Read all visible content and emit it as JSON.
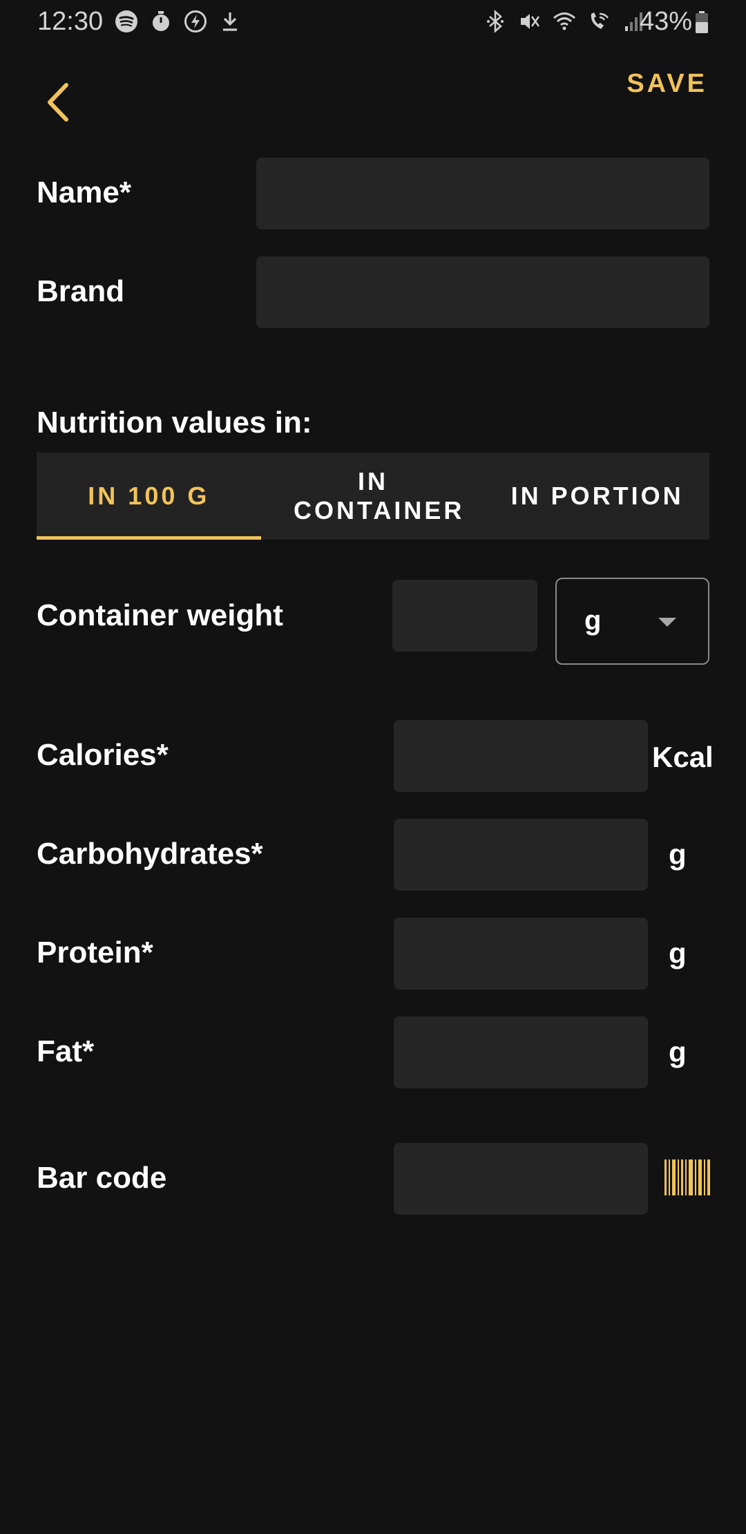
{
  "status_bar": {
    "time": "12:30",
    "battery": "43%",
    "left_icons": [
      "spotify-icon",
      "stopwatch-icon",
      "flash-icon",
      "download-icon"
    ],
    "right_icons": [
      "bluetooth-icon",
      "mute-icon",
      "wifi-icon",
      "wifi-calling-icon",
      "signal-icon",
      "battery-icon"
    ]
  },
  "header": {
    "back_icon": "chevron-left-icon",
    "save_label": "SAVE"
  },
  "form": {
    "name_label": "Name*",
    "name_value": "",
    "brand_label": "Brand",
    "brand_value": "",
    "nutrition_heading": "Nutrition values in:",
    "tabs": [
      {
        "label": "IN 100 G",
        "active": true
      },
      {
        "label": "IN CONTAINER",
        "active": false
      },
      {
        "label": "IN PORTION",
        "active": false
      }
    ],
    "container_weight_label": "Container weight",
    "container_weight_value": "",
    "container_weight_unit": "g",
    "calories_label": "Calories*",
    "calories_value": "",
    "calories_unit": "Kcal",
    "carbs_label": "Carbohydrates*",
    "carbs_value": "",
    "carbs_unit": "g",
    "protein_label": "Protein*",
    "protein_value": "",
    "protein_unit": "g",
    "fat_label": "Fat*",
    "fat_value": "",
    "fat_unit": "g",
    "barcode_label": "Bar code",
    "barcode_value": "",
    "barcode_icon": "barcode-icon"
  },
  "colors": {
    "background": "#121212",
    "field": "#262626",
    "accent": "#f2c35a",
    "text": "#ffffff"
  }
}
